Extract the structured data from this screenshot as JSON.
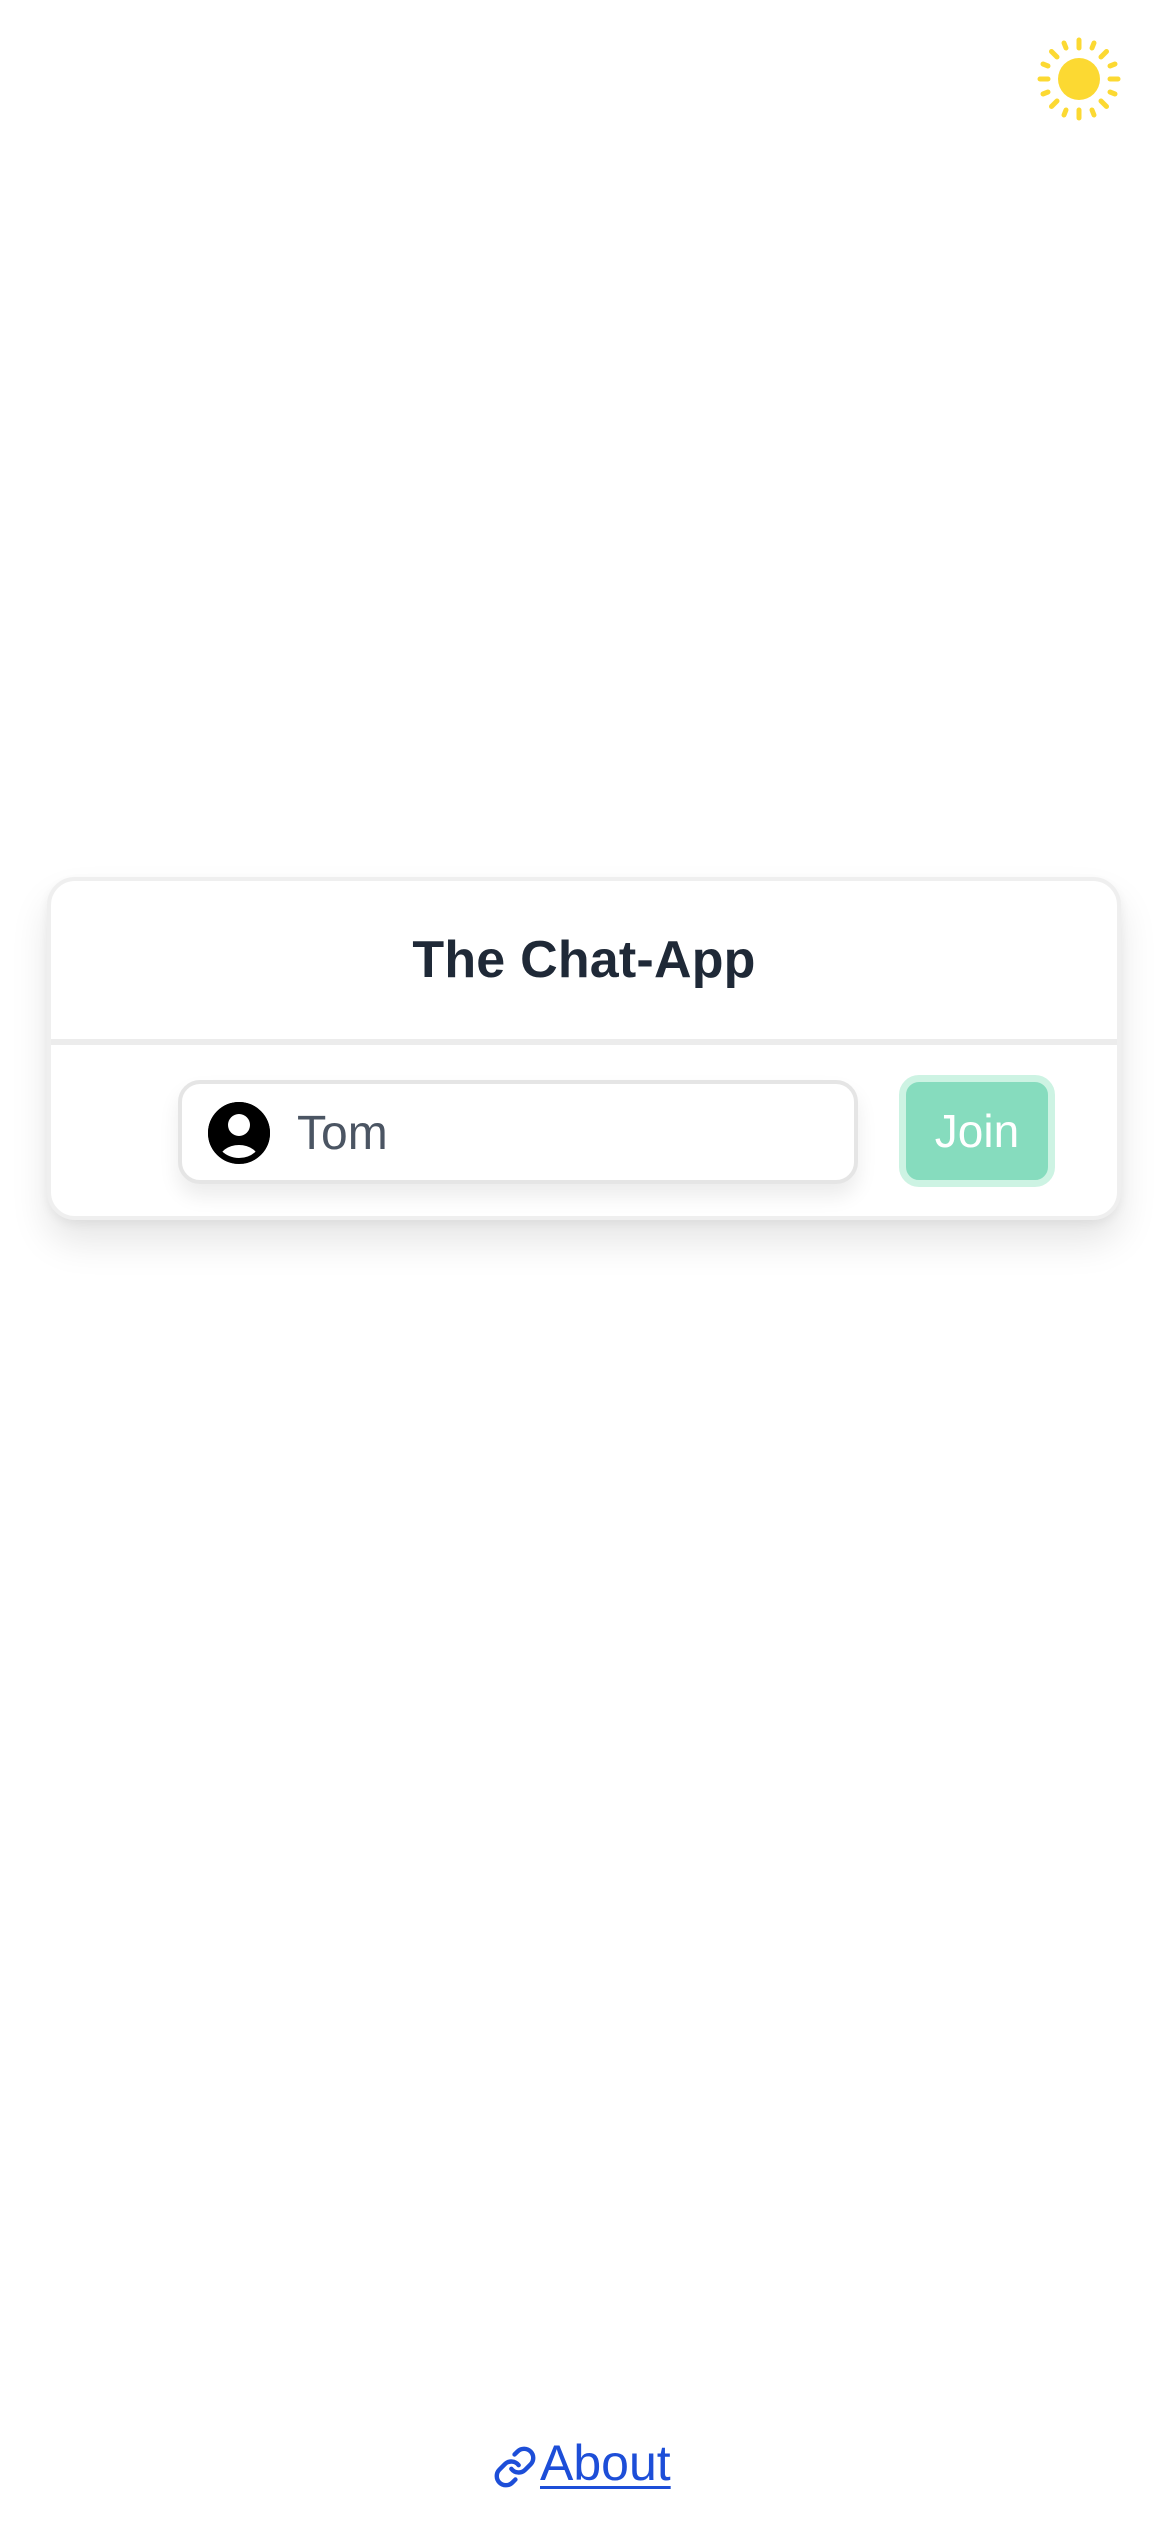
{
  "app": {
    "title": "The Chat-App"
  },
  "theme_toggle": {
    "icon": "sun-icon",
    "color": "#fcd932"
  },
  "login": {
    "name_value": "Tom",
    "name_icon": "user-circle-icon",
    "join_label": "Join",
    "join_color": "#86dcbe"
  },
  "footer": {
    "about_label": "About",
    "about_icon": "link-icon",
    "link_color": "#1d4ed8"
  }
}
